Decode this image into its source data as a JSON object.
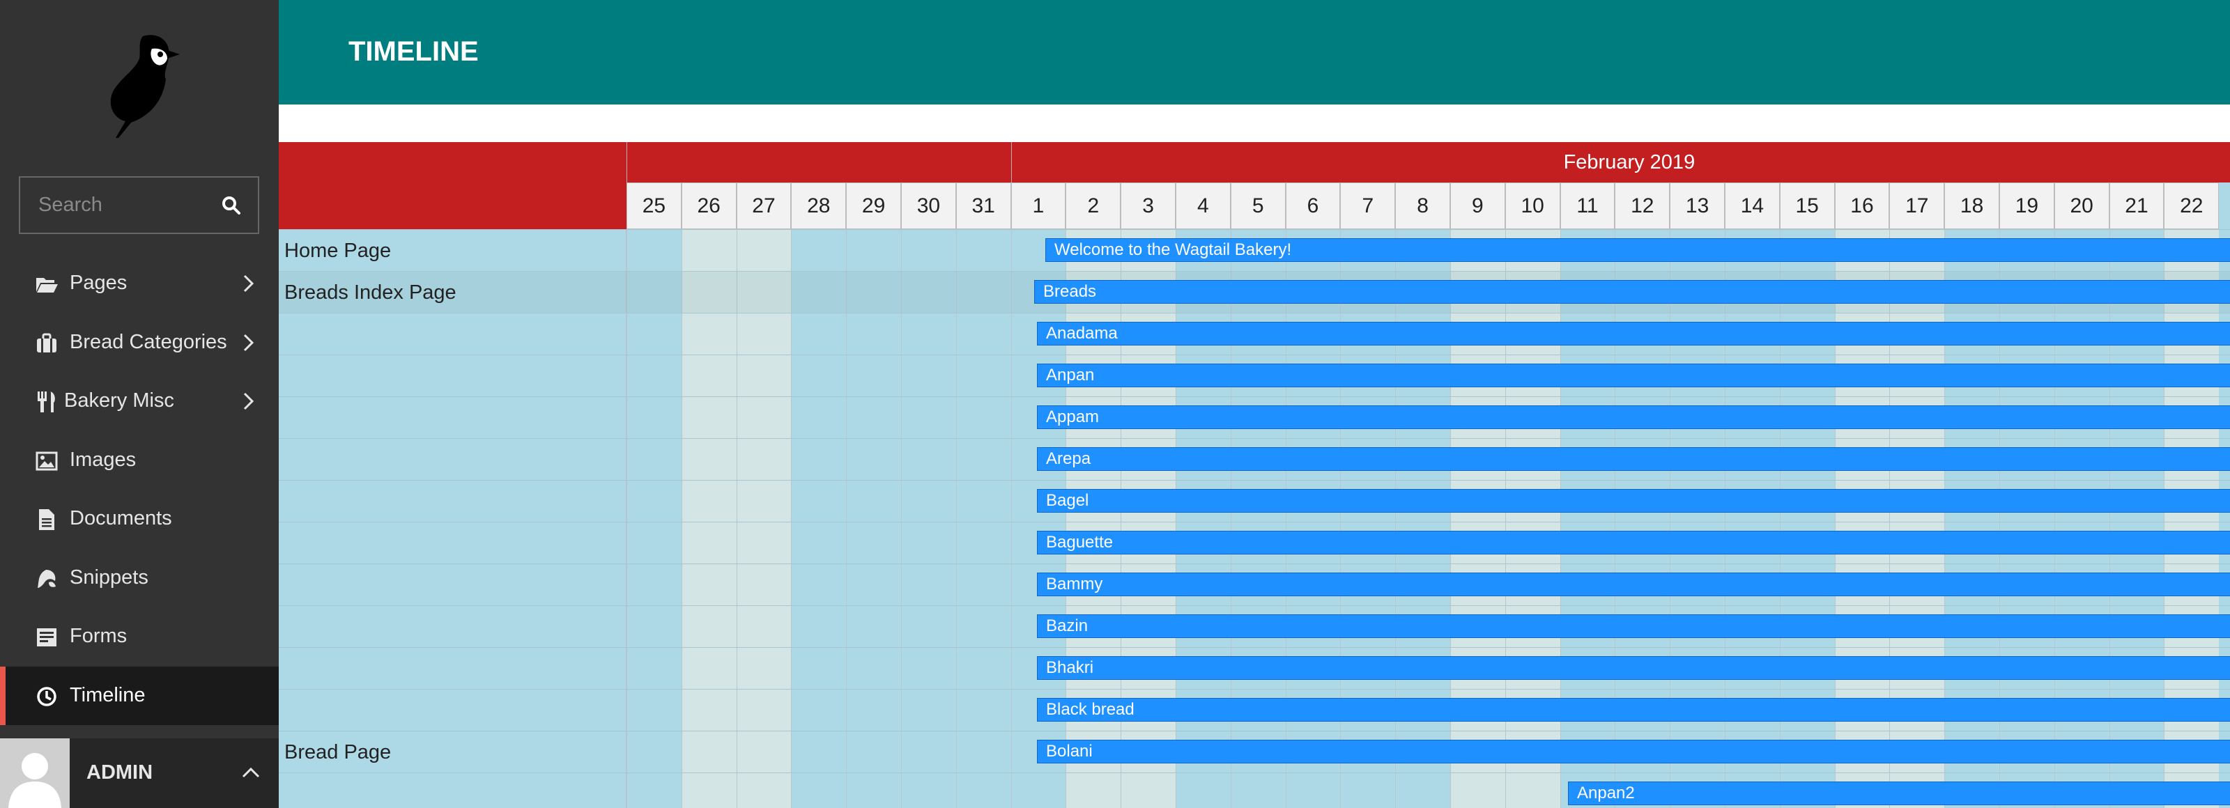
{
  "sidebar": {
    "search_placeholder": "Search",
    "items": [
      {
        "label": "Pages",
        "icon": "folder-open-icon",
        "has_submenu": true
      },
      {
        "label": "Bread Categories",
        "icon": "suitcase-icon",
        "has_submenu": true
      },
      {
        "label": "Bakery Misc",
        "icon": "utensils-icon",
        "has_submenu": true
      },
      {
        "label": "Images",
        "icon": "image-icon",
        "has_submenu": false
      },
      {
        "label": "Documents",
        "icon": "document-icon",
        "has_submenu": false
      },
      {
        "label": "Snippets",
        "icon": "snippet-icon",
        "has_submenu": false
      },
      {
        "label": "Forms",
        "icon": "form-icon",
        "has_submenu": false
      },
      {
        "label": "Timeline",
        "icon": "clock-icon",
        "has_submenu": false,
        "active": true
      }
    ],
    "account": {
      "name": "ADMIN"
    }
  },
  "header": {
    "title": "TIMELINE"
  },
  "colors": {
    "sidebar": "#333333",
    "header": "#007d7e",
    "timeline_header": "#c41f20",
    "active_indicator": "#e9564b",
    "bar": "#1e90ff",
    "row_bg": "#add8e6",
    "weekend_bg": "#d3e6e5"
  },
  "timeline": {
    "months": [
      {
        "label": ""
      },
      {
        "label": "February 2019"
      }
    ],
    "days": [
      "25",
      "26",
      "27",
      "28",
      "29",
      "30",
      "31",
      "1",
      "2",
      "3",
      "4",
      "5",
      "6",
      "7",
      "8",
      "9",
      "10",
      "11",
      "12",
      "13",
      "14",
      "15",
      "16",
      "17",
      "18",
      "19",
      "20",
      "21",
      "22"
    ],
    "rows": [
      {
        "label": "Home Page"
      },
      {
        "label": "Breads Index Page"
      },
      {
        "label": ""
      },
      {
        "label": ""
      },
      {
        "label": ""
      },
      {
        "label": ""
      },
      {
        "label": ""
      },
      {
        "label": ""
      },
      {
        "label": ""
      },
      {
        "label": ""
      },
      {
        "label": ""
      },
      {
        "label": ""
      },
      {
        "label": "Bread Page"
      },
      {
        "label": ""
      }
    ],
    "events": [
      {
        "label": "Welcome to the Wagtail Bakery!"
      },
      {
        "label": "Breads"
      },
      {
        "label": "Anadama"
      },
      {
        "label": "Anpan"
      },
      {
        "label": "Appam"
      },
      {
        "label": "Arepa"
      },
      {
        "label": "Bagel"
      },
      {
        "label": "Baguette"
      },
      {
        "label": "Bammy"
      },
      {
        "label": "Bazin"
      },
      {
        "label": "Bhakri"
      },
      {
        "label": "Black bread"
      },
      {
        "label": "Bolani"
      },
      {
        "label": "Anpan2"
      }
    ]
  }
}
